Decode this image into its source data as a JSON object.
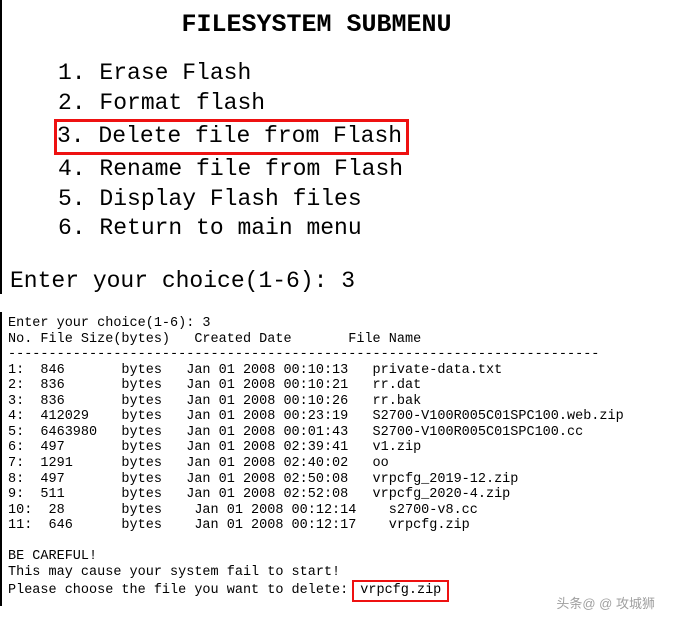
{
  "title": "FILESYSTEM SUBMENU",
  "menu": {
    "items": [
      {
        "num": "1.",
        "label": "Erase Flash"
      },
      {
        "num": "2.",
        "label": "Format flash"
      },
      {
        "num": "3.",
        "label": "Delete file from Flash"
      },
      {
        "num": "4.",
        "label": "Rename file from Flash"
      },
      {
        "num": "5.",
        "label": "Display Flash files"
      },
      {
        "num": "6.",
        "label": "Return to main menu"
      }
    ]
  },
  "prompt_top": "Enter your choice(1-6): 3",
  "listing": {
    "prompt": "Enter your choice(1-6): 3",
    "header": "No. File Size(bytes)   Created Date       File Name",
    "rule": "-------------------------------------------------------------------------",
    "rows": [
      "1:  846       bytes   Jan 01 2008 00:10:13   private-data.txt",
      "2:  836       bytes   Jan 01 2008 00:10:21   rr.dat",
      "3:  836       bytes   Jan 01 2008 00:10:26   rr.bak",
      "4:  412029    bytes   Jan 01 2008 00:23:19   S2700-V100R005C01SPC100.web.zip",
      "5:  6463980   bytes   Jan 01 2008 00:01:43   S2700-V100R005C01SPC100.cc",
      "6:  497       bytes   Jan 01 2008 02:39:41   v1.zip",
      "7:  1291      bytes   Jan 01 2008 02:40:02   oo",
      "8:  497       bytes   Jan 01 2008 02:50:08   vrpcfg_2019-12.zip",
      "9:  511       bytes   Jan 01 2008 02:52:08   vrpcfg_2020-4.zip",
      "10:  28       bytes    Jan 01 2008 00:12:14    s2700-v8.cc",
      "11:  646      bytes    Jan 01 2008 00:12:17    vrpcfg.zip"
    ],
    "warn1": "BE CAREFUL!",
    "warn2": "This may cause your system fail to start!",
    "choose": "Please choose the file you want to delete:",
    "target": "vrpcfg.zip"
  },
  "watermark": "头条@  @ 攻城狮"
}
